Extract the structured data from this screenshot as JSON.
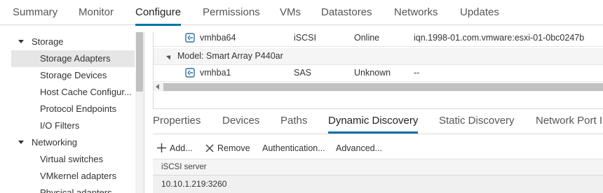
{
  "top_tabs": [
    "Summary",
    "Monitor",
    "Configure",
    "Permissions",
    "VMs",
    "Datastores",
    "Networks",
    "Updates"
  ],
  "active_top_tab": "Configure",
  "nav": {
    "storage_label": "Storage",
    "storage_items": [
      "Storage Adapters",
      "Storage Devices",
      "Host Cache Configur...",
      "Protocol Endpoints",
      "I/O Filters"
    ],
    "networking_label": "Networking",
    "networking_items": [
      "Virtual switches",
      "VMkernel adapters",
      "Physical adapters"
    ],
    "selected": "Storage Adapters"
  },
  "adapters": {
    "rows": [
      {
        "adapter": "vmhba64",
        "type": "iSCSI",
        "status": "Online",
        "identifier": "iqn.1998-01.com.vmware:esxi-01-0bc0247b"
      },
      {
        "adapter": "vmhba1",
        "type": "SAS",
        "status": "Unknown",
        "identifier": "--"
      }
    ],
    "group_label": "Model: Smart Array P440ar"
  },
  "detail_tabs": [
    "Properties",
    "Devices",
    "Paths",
    "Dynamic Discovery",
    "Static Discovery",
    "Network Port I"
  ],
  "active_detail_tab": "Dynamic Discovery",
  "toolbar": {
    "add": "Add...",
    "remove": "Remove",
    "authentication": "Authentication...",
    "advanced": "Advanced..."
  },
  "servers": {
    "header": "iSCSI server",
    "rows": [
      "10.10.1.219:3260"
    ]
  },
  "colors": {
    "accent": "#0072a3",
    "selected_bg": "#e6e6e6",
    "icon": "#2f6f9f"
  },
  "icons": {
    "adapter": "storage-adapter-icon",
    "add": "plus-icon",
    "remove": "x-icon"
  }
}
